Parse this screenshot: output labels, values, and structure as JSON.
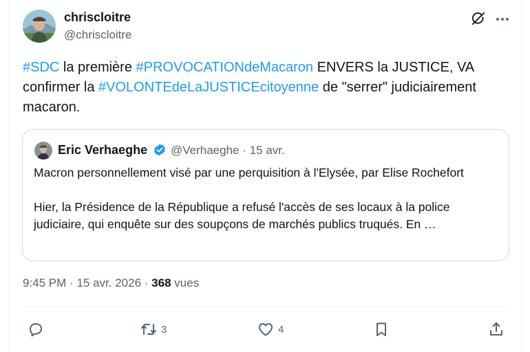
{
  "author": {
    "display_name": "chriscloitre",
    "handle": "@chriscloitre"
  },
  "tweet": {
    "segments": [
      {
        "text": "#SDC",
        "hashtag": true
      },
      {
        "text": " la première ",
        "hashtag": false
      },
      {
        "text": "#PROVOCATIONdeMacaron",
        "hashtag": true
      },
      {
        "text": " ENVERS la JUSTICE, VA confirmer la ",
        "hashtag": false
      },
      {
        "text": "#VOLONTEdeLaJUSTICEcitoyenne",
        "hashtag": true
      },
      {
        "text": " de \"serrer\" judiciairement macaron.",
        "hashtag": false
      }
    ]
  },
  "quote": {
    "display_name": "Eric Verhaeghe",
    "handle": "@Verhaeghe",
    "separator": "·",
    "date": "15 avr.",
    "text": "Macron personnellement visé par une perquisition à l'Elysée, par Elise Rochefort\n\nHier, la Présidence de la République a refusé l'accès de ses locaux à la police judiciaire, qui enquête sur des soupçons de marchés publics truqués. En …"
  },
  "meta": {
    "time": "9:45 PM",
    "sep1": "·",
    "date": "15 avr. 2026",
    "sep2": "·",
    "views_count": "368",
    "views_label": "vues"
  },
  "actions": {
    "reply_count": "",
    "retweet_count": "3",
    "like_count": "4"
  },
  "colors": {
    "link": "#1d9bf0",
    "muted": "#536471",
    "text": "#0f1419",
    "verified": "#1d9bf0"
  },
  "icons": [
    "grok-icon",
    "more-icon",
    "verified-badge-icon",
    "reply-icon",
    "retweet-icon",
    "like-icon",
    "bookmark-icon",
    "share-icon"
  ]
}
